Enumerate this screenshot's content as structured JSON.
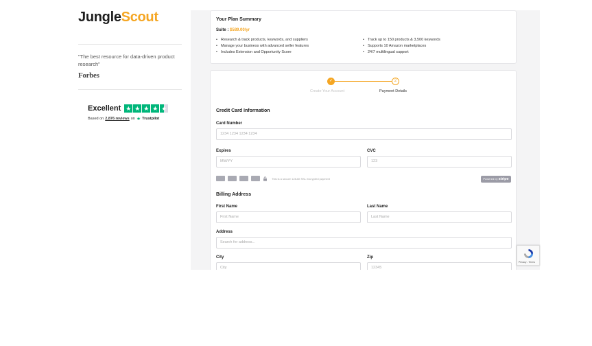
{
  "brand": {
    "logo_part1": "Jungle",
    "logo_part2": "Scout"
  },
  "testimonial": {
    "quote": "\"The best resource for data-driven product research\"",
    "source": "Forbes"
  },
  "trustpilot": {
    "rating_label": "Excellent",
    "based_on": "Based on",
    "reviews": "2,876 reviews",
    "on": "on",
    "brand": "Trustpilot"
  },
  "plan": {
    "title": "Your Plan Summary",
    "suite_label": "Suite",
    "price": "$589.00/yr",
    "features_left": [
      "Research & track products, keywords, and suppliers",
      "Manage your business with advanced seller features",
      "Includes Extension and Opportunity Score"
    ],
    "features_right": [
      "Track up to 150 products & 3,500 keywords",
      "Supports 10 Amazon marketplaces",
      "24/7 multilingual support"
    ]
  },
  "stepper": {
    "step1_label": "Create Your Account",
    "step1_mark": "✓",
    "step2_label": "Payment Details",
    "step2_number": "2"
  },
  "credit_card": {
    "title": "Credit Card Information",
    "card_number_label": "Card Number",
    "card_number_placeholder": "1234 1234 1234 1234",
    "expires_label": "Expires",
    "expires_placeholder": "MM/YY",
    "cvc_label": "CVC",
    "cvc_placeholder": "123",
    "secure_text": "This is a secure 128-bit SSL encrypted payment",
    "powered_by": "Powered by",
    "stripe": "stripe"
  },
  "billing": {
    "title": "Billing Address",
    "first_name_label": "First Name",
    "first_name_placeholder": "First Name",
    "last_name_label": "Last Name",
    "last_name_placeholder": "Last Name",
    "address_label": "Address",
    "address_placeholder": "Search for address...",
    "city_label": "City",
    "city_placeholder": "City",
    "zip_label": "Zip",
    "zip_placeholder": "12345"
  },
  "recaptcha": {
    "links": "Privacy - Terms"
  },
  "colors": {
    "accent": "#f5a623",
    "trustpilot_green": "#00b67a",
    "panel_bg": "#f4f4f5"
  },
  "icons": [
    "check-icon",
    "lock-icon",
    "star-icon",
    "recaptcha-icon",
    "credit-card-icon"
  ]
}
